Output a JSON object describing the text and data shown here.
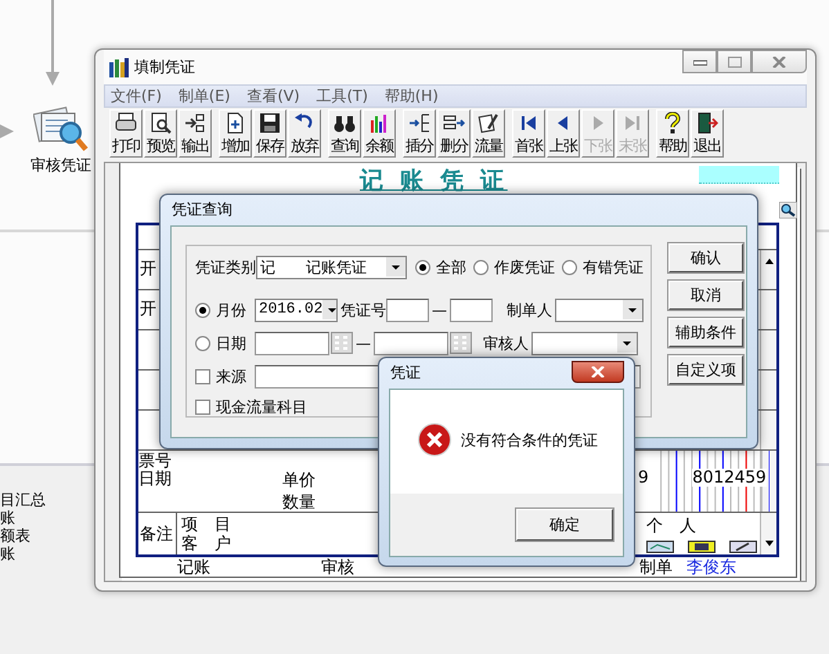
{
  "desktop": {
    "node_label": "审核凭证",
    "menu_items": [
      "目汇总",
      "账",
      "额表",
      "账"
    ]
  },
  "window": {
    "title": "填制凭证",
    "menu": [
      "文件(F)",
      "制单(E)",
      "查看(V)",
      "工具(T)",
      "帮助(H)"
    ],
    "toolbar": [
      [
        {
          "label": "打印",
          "disabled": false
        },
        {
          "label": "预览",
          "disabled": false
        },
        {
          "label": "输出",
          "disabled": false
        }
      ],
      [
        {
          "label": "增加",
          "disabled": false
        },
        {
          "label": "保存",
          "disabled": false
        },
        {
          "label": "放弃",
          "disabled": false
        }
      ],
      [
        {
          "label": "查询",
          "disabled": false
        },
        {
          "label": "余额",
          "disabled": false
        }
      ],
      [
        {
          "label": "插分",
          "disabled": false
        },
        {
          "label": "删分",
          "disabled": false
        },
        {
          "label": "流量",
          "disabled": false
        }
      ],
      [
        {
          "label": "首张",
          "disabled": false
        },
        {
          "label": "上张",
          "disabled": false
        },
        {
          "label": "下张",
          "disabled": true
        },
        {
          "label": "末张",
          "disabled": true
        }
      ],
      [
        {
          "label": "帮助",
          "disabled": false
        },
        {
          "label": "退出",
          "disabled": false
        }
      ]
    ]
  },
  "voucher": {
    "title": "记 账 凭 证",
    "row_labels": [
      "开",
      "开"
    ],
    "ticket_label": "票号",
    "date_label": "日期",
    "unit_price_label": "单价",
    "quantity_label": "数量",
    "amount_partial": "9",
    "amount": "8012459",
    "notes_label": "备注",
    "project_label": "项　目",
    "customer_label": "客　户",
    "person_label": "个　人",
    "bookkeeping_label": "记账",
    "review_label": "审核",
    "maker_label": "制单",
    "maker": "李俊东"
  },
  "query_dialog": {
    "title": "凭证查询",
    "type_label": "凭证类别",
    "type_value": "记　　记账凭证",
    "status_options": [
      {
        "label": "全部",
        "selected": true
      },
      {
        "label": "作废凭证",
        "selected": false
      },
      {
        "label": "有错凭证",
        "selected": false
      }
    ],
    "month": {
      "label": "月份",
      "selected": true,
      "value": "2016.02"
    },
    "voucher_no_label": "凭证号",
    "range_dash_1": "—",
    "maker_label": "制单人",
    "date": {
      "label": "日期",
      "selected": false
    },
    "range_dash_2": "—",
    "reviewer_label": "审核人",
    "source": {
      "label": "来源",
      "checked": false
    },
    "cash_flow": {
      "label": "现金流量科目",
      "checked": false
    },
    "buttons": [
      "确认",
      "取消",
      "辅助条件",
      "自定义项"
    ]
  },
  "message_box": {
    "title": "凭证",
    "message": "没有符合条件的凭证",
    "button": "确定"
  }
}
